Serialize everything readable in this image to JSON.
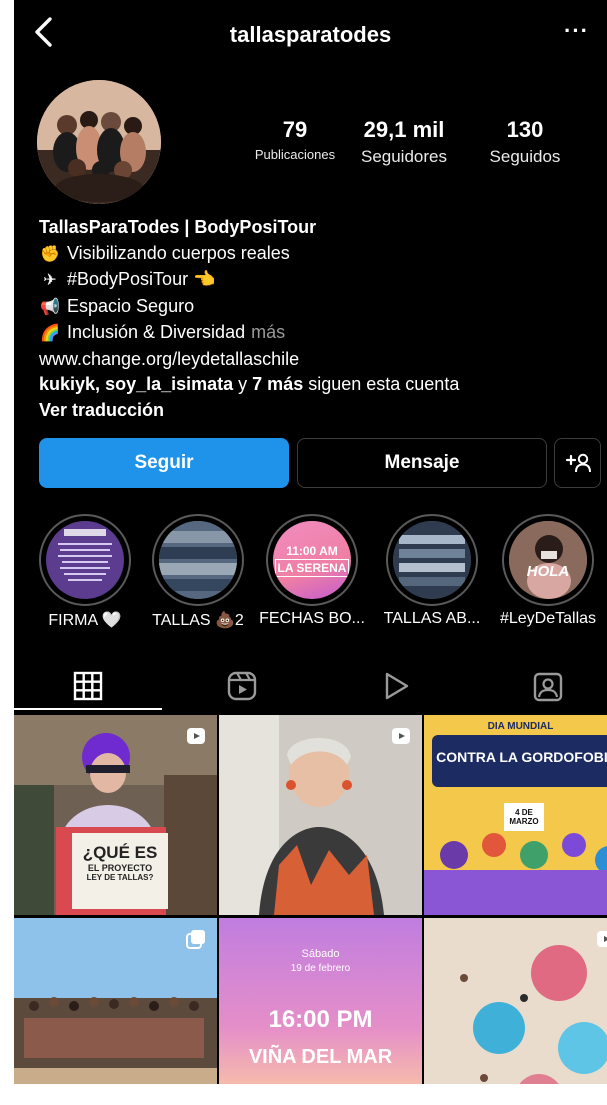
{
  "header": {
    "username": "tallasparatodes",
    "back_icon": "chevron-left-icon",
    "more_icon": "more-horizontal-icon",
    "more_label": "···"
  },
  "profile": {
    "stats": [
      {
        "value": "79",
        "label": "Publicaciones"
      },
      {
        "value": "29,1 mil",
        "label": "Seguidores"
      },
      {
        "value": "130",
        "label": "Seguidos"
      }
    ],
    "bio": {
      "name": "TallasParaTodes | BodyPosiTour",
      "lines": [
        {
          "emoji": "✊",
          "text": "Visibilizando cuerpos reales"
        },
        {
          "emoji": "✈",
          "text": "#BodyPosiTour 👈"
        },
        {
          "emoji": "📢",
          "text": "Espacio Seguro"
        },
        {
          "emoji": "🌈",
          "text": "Inclusión & Diversidad"
        }
      ],
      "more": "más",
      "link": "www.change.org/leydetallaschile",
      "followers_user1": "kukiyk",
      "followers_sep": ", ",
      "followers_user2": "soy_la_isimata",
      "followers_y": " y ",
      "followers_more": "7 más",
      "followers_suffix": " siguen esta cuenta",
      "translate": "Ver traducción"
    }
  },
  "actions": {
    "follow": "Seguir",
    "message": "Mensaje",
    "add_icon": "add-person-icon",
    "add_label": "+"
  },
  "highlights": [
    {
      "caption": "FIRMA 🤍",
      "text": ""
    },
    {
      "caption": "TALLAS 💩2",
      "text": ""
    },
    {
      "caption": "FECHAS BO...",
      "text": "11:00 AM",
      "text2": "LA SERENA"
    },
    {
      "caption": "TALLAS AB...",
      "text": ""
    },
    {
      "caption": "#LeyDeTallas",
      "text": "HOLA"
    }
  ],
  "tabs": [
    {
      "icon": "grid-icon"
    },
    {
      "icon": "reels-icon"
    },
    {
      "icon": "play-icon"
    },
    {
      "icon": "tagged-icon"
    }
  ],
  "posts": [
    {
      "kind": "reel",
      "title1": "¿QUÉ ES",
      "title2": "EL PROYECTO",
      "title3": "LEY DE TALLAS?"
    },
    {
      "kind": "reel"
    },
    {
      "kind": "carousel",
      "title1": "DIA MUNDIAL",
      "title2": "CONTRA LA GORDOFOBIA",
      "title3": "4 DE MARZO"
    },
    {
      "kind": "carousel"
    },
    {
      "kind": "post",
      "title1": "Sábado",
      "title2": "19 de febrero",
      "title3": "16:00 PM",
      "title4": "VIÑA DEL MAR"
    },
    {
      "kind": "reel"
    }
  ],
  "colors": {
    "accent": "#1f93ea",
    "background": "#000000"
  }
}
